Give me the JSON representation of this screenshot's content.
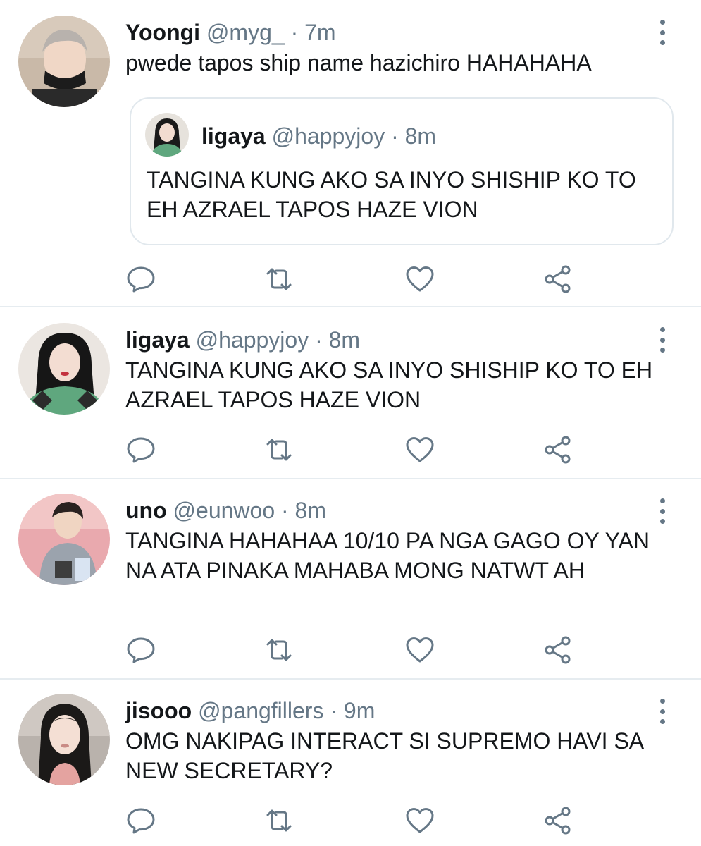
{
  "tweets": [
    {
      "name": "Yoongi",
      "handle": "@myg_",
      "time": "· 7m",
      "text": "pwede tapos ship name hazichiro HAHAHAHA",
      "quote": {
        "name": "ligaya",
        "handle": "@happyjoy",
        "time": "· 8m",
        "text": "TANGINA KUNG AKO SA INYO SHISHIP KO TO EH AZRAEL TAPOS HAZE VION"
      }
    },
    {
      "name": "ligaya",
      "handle": "@happyjoy",
      "time": "· 8m",
      "text": "TANGINA KUNG AKO SA INYO SHISHIP KO TO EH AZRAEL TAPOS HAZE VION"
    },
    {
      "name": "uno",
      "handle": "@eunwoo",
      "time": "· 8m",
      "text": "TANGINA HAHAHAA 10/10 PA NGA GAGO OY YAN NA ATA PINAKA MAHABA MONG NATWT AH"
    },
    {
      "name": "jisooo",
      "handle": "@pangfillers",
      "time": "· 9m",
      "text": "OMG NAKIPAG INTERACT SI SUPREMO HAVI SA NEW SECRETARY?"
    }
  ],
  "icons": {
    "more": "more-vertical-icon",
    "reply": "reply-icon",
    "retweet": "retweet-icon",
    "like": "heart-icon",
    "share": "share-icon"
  },
  "colors": {
    "text": "#14171a",
    "muted": "#657786",
    "divider": "#e6ecf0"
  }
}
